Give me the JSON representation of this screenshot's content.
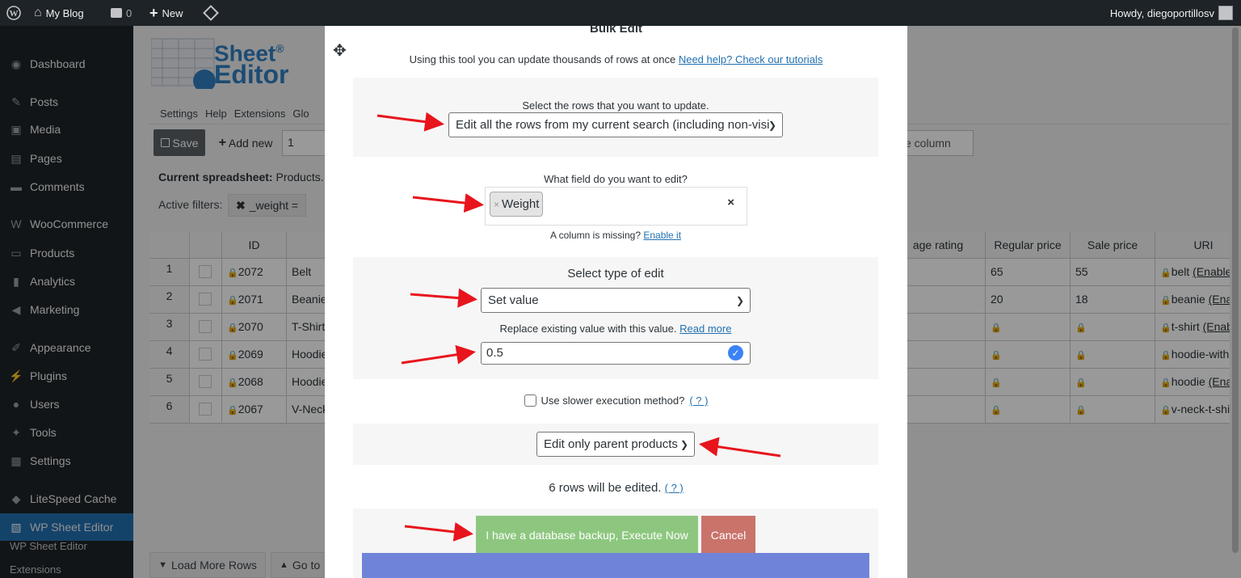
{
  "adminbar": {
    "site_name": "My Blog",
    "comments_count": "0",
    "new_label": "New",
    "howdy": "Howdy, diegoportillosv"
  },
  "sidebar": {
    "items": [
      {
        "label": "Dashboard",
        "icon": "dashboard-icon"
      },
      {
        "label": "Posts",
        "icon": "pin-icon"
      },
      {
        "label": "Media",
        "icon": "media-icon"
      },
      {
        "label": "Pages",
        "icon": "page-icon"
      },
      {
        "label": "Comments",
        "icon": "comment-icon"
      },
      {
        "label": "WooCommerce",
        "icon": "woo-icon"
      },
      {
        "label": "Products",
        "icon": "archive-icon"
      },
      {
        "label": "Analytics",
        "icon": "bar-chart-icon"
      },
      {
        "label": "Marketing",
        "icon": "megaphone-icon"
      },
      {
        "label": "Appearance",
        "icon": "brush-icon"
      },
      {
        "label": "Plugins",
        "icon": "plug-icon"
      },
      {
        "label": "Users",
        "icon": "user-icon"
      },
      {
        "label": "Tools",
        "icon": "wrench-icon"
      },
      {
        "label": "Settings",
        "icon": "settings-icon"
      },
      {
        "label": "LiteSpeed Cache",
        "icon": "diamond-icon"
      },
      {
        "label": "WP Sheet Editor",
        "icon": "sheet-icon"
      }
    ],
    "submenu": [
      "WP Sheet Editor",
      "Extensions"
    ]
  },
  "sheet": {
    "logo_top": "Sheet",
    "logo_bottom": "Editor",
    "logo_mark": "®",
    "menu": [
      "Settings",
      "Help",
      "Extensions",
      "Glo"
    ],
    "save_label": "Save",
    "add_new_label": "Add new",
    "add_new_count": "1",
    "column_search_placeholder": "e column",
    "current_spreadsheet_label": "Current spreadsheet:",
    "current_spreadsheet_value": "Products. F",
    "active_filters_label": "Active filters:",
    "filter_chip": "_weight =",
    "columns_left": [
      "",
      "",
      "ID",
      ""
    ],
    "columns_right": [
      "age rating",
      "Regular price",
      "Sale price",
      "URI"
    ],
    "rows": [
      {
        "n": "1",
        "id": "2072",
        "title": "Belt",
        "regular": "65",
        "sale": "55",
        "uri": "belt",
        "uri_link": "(Enable"
      },
      {
        "n": "2",
        "id": "2071",
        "title": "Beanie",
        "regular": "20",
        "sale": "18",
        "uri": "beanie",
        "uri_link": "(Ena"
      },
      {
        "n": "3",
        "id": "2070",
        "title": "T-Shirt",
        "regular": "",
        "sale": "",
        "uri": "t-shirt",
        "uri_link": "(Enab"
      },
      {
        "n": "4",
        "id": "2069",
        "title": "Hoodie",
        "regular": "",
        "sale": "",
        "uri": "hoodie-with",
        "uri_link": ""
      },
      {
        "n": "5",
        "id": "2068",
        "title": "Hoodie",
        "regular": "",
        "sale": "",
        "uri": "hoodie",
        "uri_link": "(Ena"
      },
      {
        "n": "6",
        "id": "2067",
        "title": "V-Neck",
        "regular": "",
        "sale": "",
        "uri": "v-neck-t-shi",
        "uri_link": ""
      }
    ],
    "load_more": "Load More Rows",
    "go_to": "Go to"
  },
  "modal": {
    "title": "Bulk Edit",
    "intro": "Using this tool you can update thousands of rows at once",
    "intro_link": "Need help? Check our tutorials",
    "rows_label": "Select the rows that you want to update.",
    "rows_select": "Edit all the rows from my current search (including non-visil",
    "field_label": "What field do you want to edit?",
    "field_tag": "Weight",
    "field_tag_remove": "×",
    "field_clear": "×",
    "missing_text": "A column is missing?",
    "missing_link": "Enable it",
    "type_label": "Select type of edit",
    "type_select": "Set value",
    "replace_text": "Replace existing value with this value.",
    "replace_link": "Read more",
    "value_input": "0.5",
    "slower_label": "Use slower execution method?",
    "slower_help": "( ? )",
    "parent_select": "Edit only parent products",
    "rows_count": "6 rows will be edited.",
    "rows_help": "( ? )",
    "execute_label": "I have a database backup, Execute Now",
    "cancel_label": "Cancel"
  },
  "colors": {
    "admin_dark": "#1d2327",
    "wp_blue": "#2271b1",
    "execute_green": "#8dc77f",
    "cancel_red": "#c9736b",
    "progress_blue": "#6f84d8",
    "arrow_red": "#e8141c"
  }
}
